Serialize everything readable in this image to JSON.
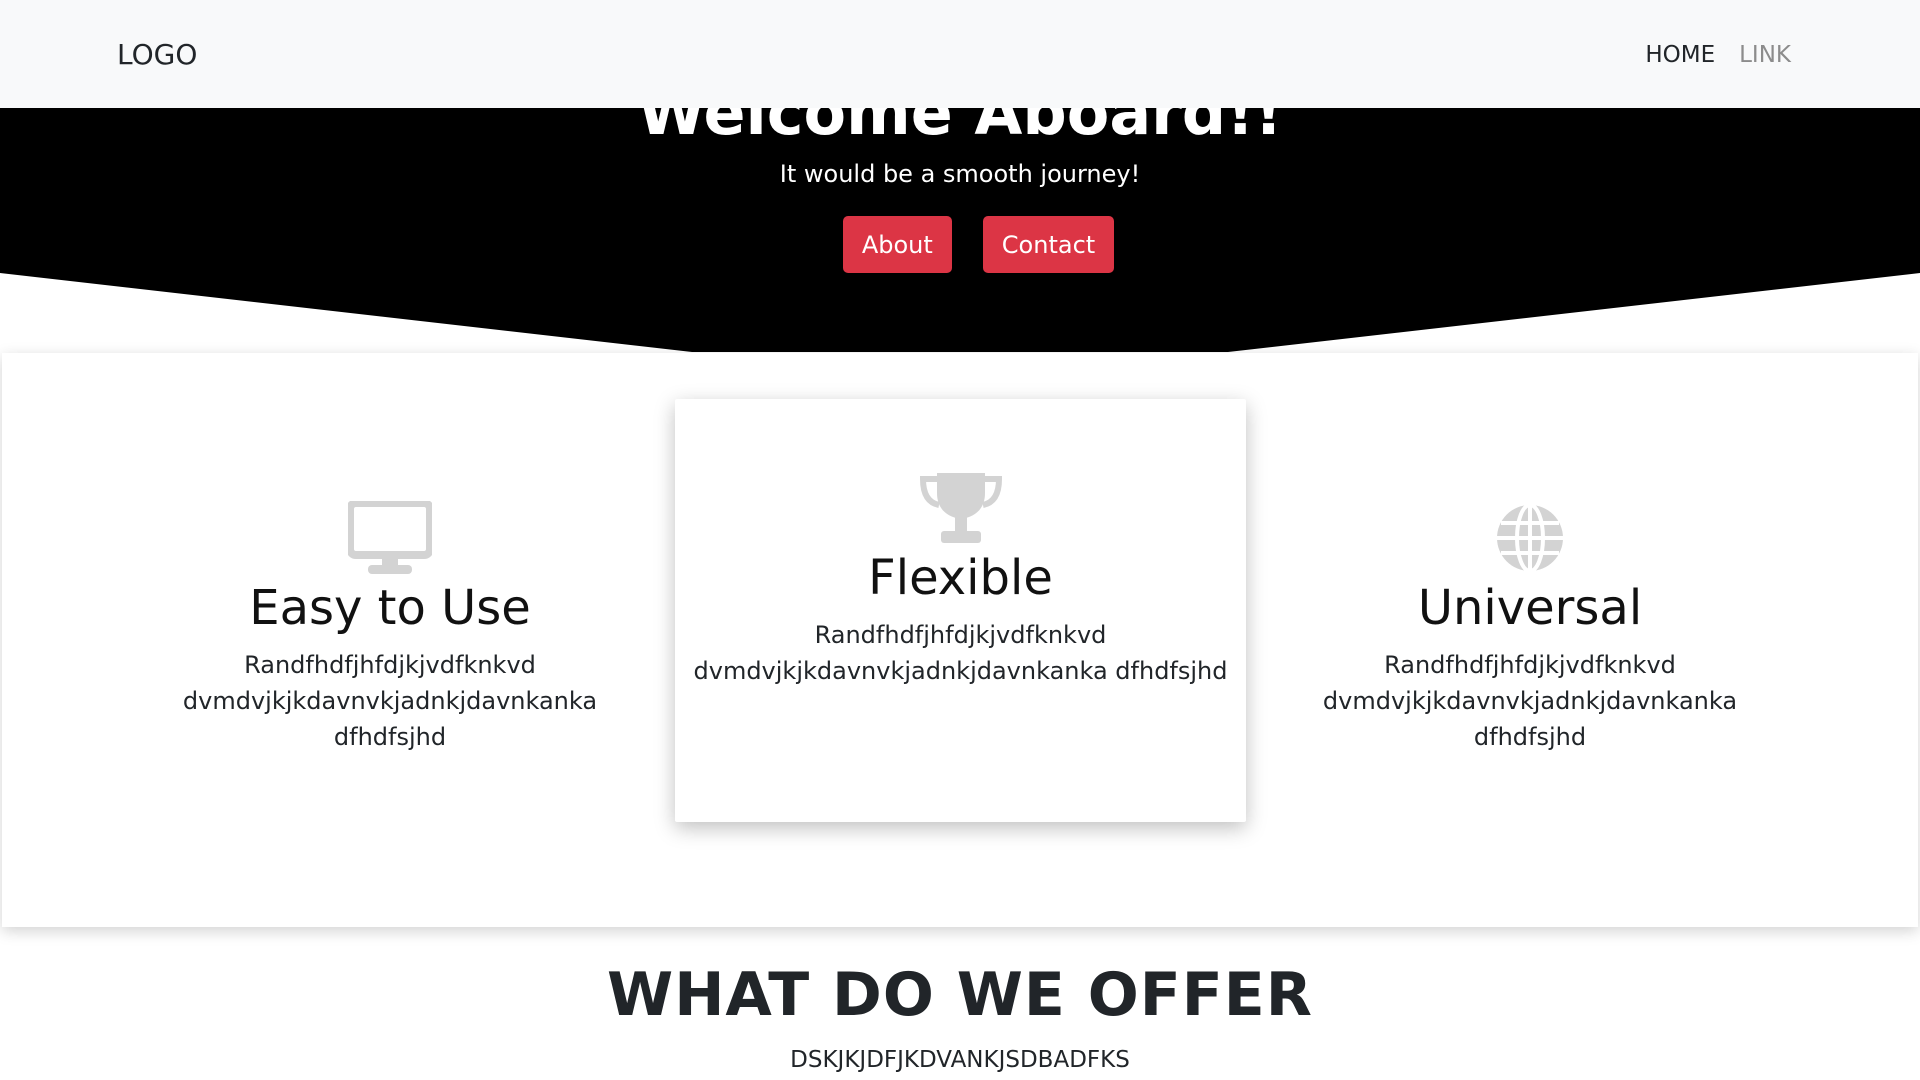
{
  "navbar": {
    "logo": "LOGO",
    "links": [
      {
        "label": "HOME"
      },
      {
        "label": "LINK"
      }
    ]
  },
  "hero": {
    "title": "Welcome Aboard!!",
    "subtitle": "It would be a smooth journey!",
    "buttons": [
      {
        "label": "About"
      },
      {
        "label": "Contact"
      }
    ]
  },
  "features": [
    {
      "icon": "monitor-icon",
      "title": "Easy to Use",
      "text": "Randfhdfjhfdjkjvdfknkvd dvmdvjkjkdavnvkjadnkjdavnkanka dfhdfsjhd"
    },
    {
      "icon": "trophy-icon",
      "title": "Flexible",
      "text": "Randfhdfjhfdjkjvdfknkvd dvmdvjkjkdavnvkjadnkjdavnkanka dfhdfsjhd"
    },
    {
      "icon": "globe-icon",
      "title": "Universal",
      "text": "Randfhdfjhfdjkjvdfknkvd dvmdvjkjkdavnvkjadnkjdavnkanka dfhdfsjhd"
    }
  ],
  "offer": {
    "title": "WHAT DO WE OFFER",
    "subtitle": "DSKJKJDFJKDVANKJSDBADFKS"
  },
  "colors": {
    "accent": "#dc3545",
    "hero_bg": "#000000",
    "navbar_bg": "#f8f9fa",
    "icon_gray": "#d3d3d3"
  }
}
